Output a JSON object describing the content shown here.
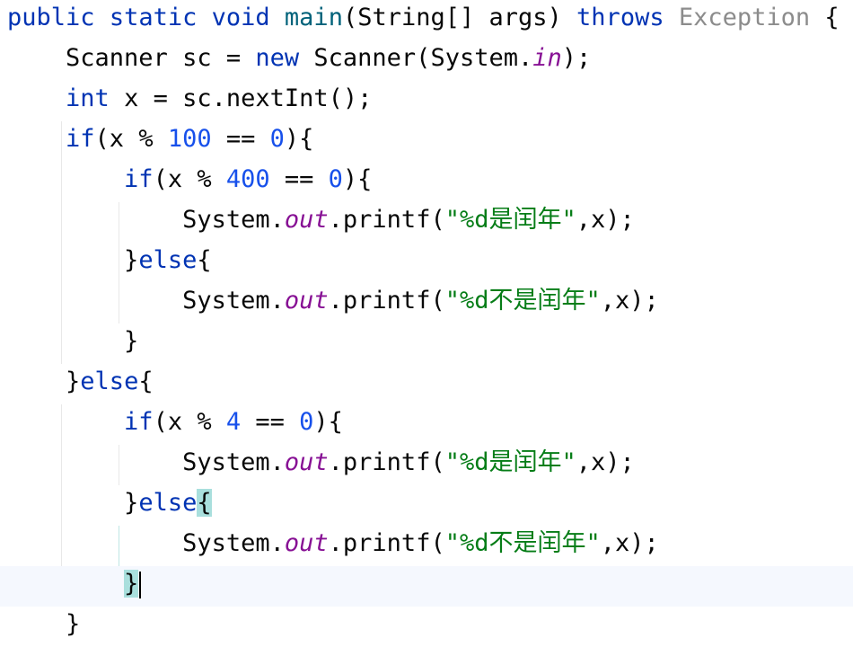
{
  "editor": {
    "code_lines": [
      {
        "indent": "",
        "tokens": [
          {
            "t": "public",
            "c": "kw"
          },
          {
            "t": " ",
            "c": ""
          },
          {
            "t": "static",
            "c": "kw"
          },
          {
            "t": " ",
            "c": ""
          },
          {
            "t": "void",
            "c": "kw"
          },
          {
            "t": " ",
            "c": ""
          },
          {
            "t": "main",
            "c": "fn"
          },
          {
            "t": "(String[] args) ",
            "c": ""
          },
          {
            "t": "throws",
            "c": "kw"
          },
          {
            "t": " ",
            "c": ""
          },
          {
            "t": "Exception",
            "c": "muted"
          },
          {
            "t": " {",
            "c": ""
          }
        ]
      },
      {
        "indent": "    ",
        "tokens": [
          {
            "t": "Scanner sc = ",
            "c": ""
          },
          {
            "t": "new",
            "c": "kw"
          },
          {
            "t": " Scanner(System.",
            "c": ""
          },
          {
            "t": "in",
            "c": "field"
          },
          {
            "t": ");",
            "c": ""
          }
        ]
      },
      {
        "indent": "    ",
        "tokens": [
          {
            "t": "int",
            "c": "kw"
          },
          {
            "t": " x = sc.nextInt();",
            "c": ""
          }
        ]
      },
      {
        "indent": "    ",
        "tokens": [
          {
            "t": "if",
            "c": "kw"
          },
          {
            "t": "(x % ",
            "c": ""
          },
          {
            "t": "100",
            "c": "num"
          },
          {
            "t": " == ",
            "c": ""
          },
          {
            "t": "0",
            "c": "num"
          },
          {
            "t": "){",
            "c": ""
          }
        ]
      },
      {
        "indent": "        ",
        "tokens": [
          {
            "t": "if",
            "c": "kw"
          },
          {
            "t": "(x % ",
            "c": ""
          },
          {
            "t": "400",
            "c": "num"
          },
          {
            "t": " == ",
            "c": ""
          },
          {
            "t": "0",
            "c": "num"
          },
          {
            "t": "){",
            "c": ""
          }
        ]
      },
      {
        "indent": "            ",
        "tokens": [
          {
            "t": "System.",
            "c": ""
          },
          {
            "t": "out",
            "c": "field"
          },
          {
            "t": ".printf(",
            "c": ""
          },
          {
            "t": "\"%d是闰年\"",
            "c": "str"
          },
          {
            "t": ",x);",
            "c": ""
          }
        ]
      },
      {
        "indent": "        ",
        "tokens": [
          {
            "t": "}",
            "c": ""
          },
          {
            "t": "else",
            "c": "kw"
          },
          {
            "t": "{",
            "c": ""
          }
        ]
      },
      {
        "indent": "            ",
        "tokens": [
          {
            "t": "System.",
            "c": ""
          },
          {
            "t": "out",
            "c": "field"
          },
          {
            "t": ".printf(",
            "c": ""
          },
          {
            "t": "\"%d不是闰年\"",
            "c": "str"
          },
          {
            "t": ",x);",
            "c": ""
          }
        ]
      },
      {
        "indent": "        ",
        "tokens": [
          {
            "t": "}",
            "c": ""
          }
        ]
      },
      {
        "indent": "    ",
        "tokens": [
          {
            "t": "}",
            "c": ""
          },
          {
            "t": "else",
            "c": "kw"
          },
          {
            "t": "{",
            "c": ""
          }
        ]
      },
      {
        "indent": "        ",
        "tokens": [
          {
            "t": "if",
            "c": "kw"
          },
          {
            "t": "(x % ",
            "c": ""
          },
          {
            "t": "4",
            "c": "num"
          },
          {
            "t": " == ",
            "c": ""
          },
          {
            "t": "0",
            "c": "num"
          },
          {
            "t": "){",
            "c": ""
          }
        ]
      },
      {
        "indent": "            ",
        "tokens": [
          {
            "t": "System.",
            "c": ""
          },
          {
            "t": "out",
            "c": "field"
          },
          {
            "t": ".printf(",
            "c": ""
          },
          {
            "t": "\"%d是闰年\"",
            "c": "str"
          },
          {
            "t": ",x);",
            "c": ""
          }
        ]
      },
      {
        "indent": "        ",
        "tokens": [
          {
            "t": "}",
            "c": ""
          },
          {
            "t": "else",
            "c": "kw"
          },
          {
            "t": "{",
            "c": "brace"
          }
        ]
      },
      {
        "indent": "            ",
        "tokens": [
          {
            "t": "System.",
            "c": ""
          },
          {
            "t": "out",
            "c": "field"
          },
          {
            "t": ".printf(",
            "c": ""
          },
          {
            "t": "\"%d不是闰年\"",
            "c": "str"
          },
          {
            "t": ",x);",
            "c": ""
          }
        ]
      },
      {
        "indent": "        ",
        "current": true,
        "tokens": [
          {
            "t": "}",
            "c": "brace"
          },
          {
            "t": "",
            "c": "caret"
          }
        ]
      },
      {
        "indent": "    ",
        "tokens": [
          {
            "t": "}",
            "c": ""
          }
        ]
      }
    ],
    "colors": {
      "keyword": "#0033b3",
      "method": "#00627a",
      "number": "#1750eb",
      "string": "#067d17",
      "field": "#871094",
      "muted": "#8c8c8c",
      "brace_match": "#a9dfdd",
      "current_line": "#f5f8fe"
    }
  }
}
